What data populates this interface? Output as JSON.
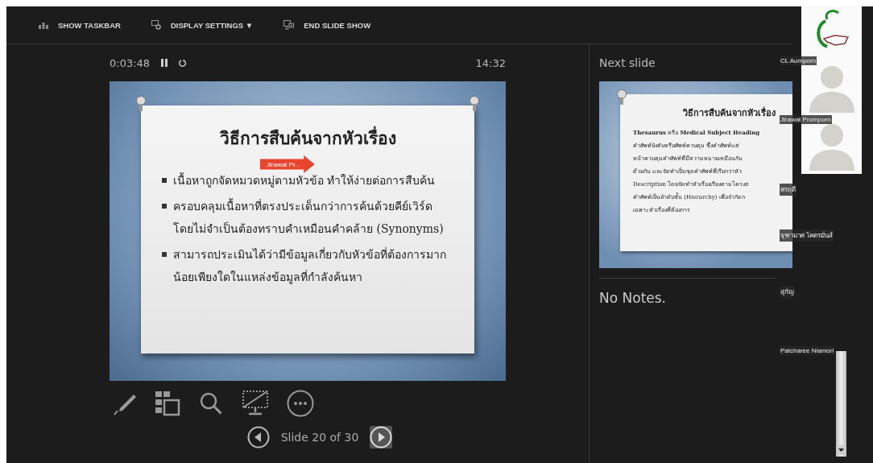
{
  "toolbar": [
    {
      "kind": "taskbar",
      "label": "SHOW TASKBAR"
    },
    {
      "kind": "display",
      "label": "DISPLAY SETTINGS ▼"
    },
    {
      "kind": "end",
      "label": "END SLIDE SHOW"
    }
  ],
  "timer": {
    "elapsed": "0:03:48",
    "clock": "14:32"
  },
  "current_slide": {
    "title": "วิธีการสืบค้นจากหัวเรื่อง",
    "bullets": [
      "เนื้อหาถูกจัดหมวดหมู่ตามหัวข้อ ทำให้ง่ายต่อการสืบค้น",
      "ครอบคลุมเนื้อหาที่ตรงประเด็นกว่าการค้นด้วยคีย์เวิร์ด โดยไม่จำเป็นต้องทราบคำเหมือนคำคล้าย (Synonyms)",
      "สามารถประเมินได้ว่ามีข้อมูลเกี่ยวกับหัวข้อที่ต้องการมากน้อยเพียงใดในแหล่งข้อมูลที่กำลังค้นหา"
    ],
    "pointer_label": "Jirawat Pr..."
  },
  "tools": [
    {
      "kind": "pen"
    },
    {
      "kind": "slides"
    },
    {
      "kind": "zoom"
    },
    {
      "kind": "blackout"
    },
    {
      "kind": "more"
    }
  ],
  "navigation": {
    "label": "Slide 20 of 30"
  },
  "next_slide": {
    "heading": "Next slide",
    "title": "วิธีการสืบค้นจากหัวเรื่อง",
    "lines": [
      "**Thesaurus** หรือ **Medical Subject Heading**",
      "คำศัพท์บังคับหรือศัพท์ควบคุม ซึ่งคำศัพท์แต่",
      "หน้าควบคุมคำศัพท์ที่มีความหมายเหมือนกัน",
      "ด้วยกัน และจัดทำเป็นชุดคำศัพท์ที่เรียกว่าหัว",
      "Description โดยจัดทำหัวเรื่องเรียงตามโครงส",
      "คำศัพท์เป็นลำดับชั้น (Hierarchy) เพื่อจำกัดก",
      "เฉพาะหัวเรื่องที่ต้องการ"
    ]
  },
  "notes": {
    "text": "No Notes."
  },
  "video_tiles": [
    {
      "kind": "logo"
    },
    {
      "kind": "avatar"
    },
    {
      "kind": "avatar"
    }
  ],
  "participants": [
    {
      "name": "CL Aumporn"
    },
    {
      "name": "Jirawat Promporn"
    },
    {
      "name": "พรฤดี"
    },
    {
      "name": "จุฑามาศ โคตรมั่นส์"
    },
    {
      "name": "สุกัญ"
    },
    {
      "name": "Patcharee Niamori"
    }
  ]
}
